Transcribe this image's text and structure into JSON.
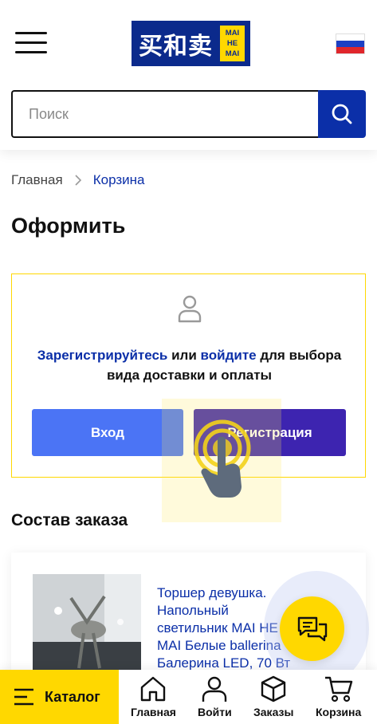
{
  "header": {
    "logo_cn": "买和卖",
    "logo_badge": [
      "MAI",
      "HE",
      "MAI"
    ],
    "menu_icon": "hamburger-icon",
    "flag": "russia-flag-icon"
  },
  "search": {
    "placeholder": "Поиск",
    "value": "",
    "button_icon": "search-icon"
  },
  "breadcrumb": {
    "home": "Главная",
    "current": "Корзина"
  },
  "page_title": "Оформить",
  "auth_card": {
    "icon": "user-icon",
    "register_link": "Зарегистрируйтесь",
    "middle": " или ",
    "login_link": "войдите",
    "rest": " для выбора вида доставки и оплаты",
    "login_button": "Вход",
    "register_button": "Регистрация"
  },
  "order": {
    "section_title": "Состав заказа",
    "items": [
      {
        "name": "Торшер девушка. Напольный светильник MAI HE MAI Белые ballerina - Балерина LED, 70 Вт"
      }
    ]
  },
  "chat": {
    "icon": "chat-icon"
  },
  "bottom_nav": {
    "catalog": "Каталог",
    "items": [
      {
        "label": "Главная",
        "icon": "home-icon"
      },
      {
        "label": "Войти",
        "icon": "user-icon"
      },
      {
        "label": "Заказы",
        "icon": "box-icon"
      },
      {
        "label": "Корзина",
        "icon": "cart-icon"
      }
    ]
  },
  "colors": {
    "brand_blue": "#0b2a8c",
    "accent_yellow": "#ffd800",
    "link_blue": "#0b2fa8",
    "login_blue": "#4b74f5",
    "register_purple": "#3d24b0"
  }
}
